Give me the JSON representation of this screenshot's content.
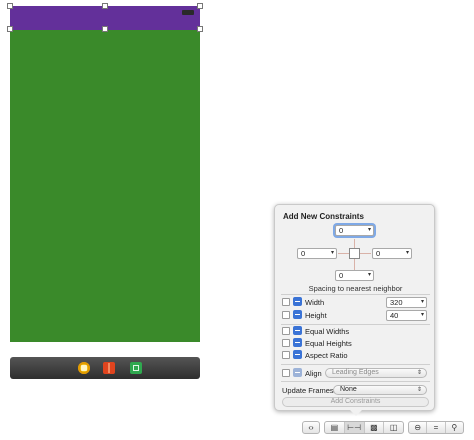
{
  "popover": {
    "title": "Add New Constraints",
    "spacing": {
      "top": "0",
      "left": "0",
      "right": "0",
      "bottom": "0",
      "label": "Spacing to nearest neighbor"
    },
    "width": {
      "label": "Width",
      "value": "320"
    },
    "height": {
      "label": "Height",
      "value": "40"
    },
    "equal_widths": "Equal Widths",
    "equal_heights": "Equal Heights",
    "aspect_ratio": "Aspect Ratio",
    "align": {
      "label": "Align",
      "value": "Leading Edges"
    },
    "update_frames": {
      "label": "Update Frames",
      "value": "None"
    },
    "add_button": "Add Constraints"
  },
  "icons": {
    "caret": "▾",
    "updown": "⇕",
    "dock": [
      "view-controller-icon",
      "first-responder-icon",
      "exit-icon"
    ],
    "toolbar": [
      "embed-icon",
      "align-icon",
      "pin-icon",
      "resolve-issues-icon",
      "resizing-icon",
      "zoom-out-icon",
      "zoom-fit-icon",
      "zoom-in-icon"
    ]
  },
  "colors": {
    "navbar": "#63309a",
    "content_view": "#3a8a2a",
    "accent": "#3a73d6"
  }
}
